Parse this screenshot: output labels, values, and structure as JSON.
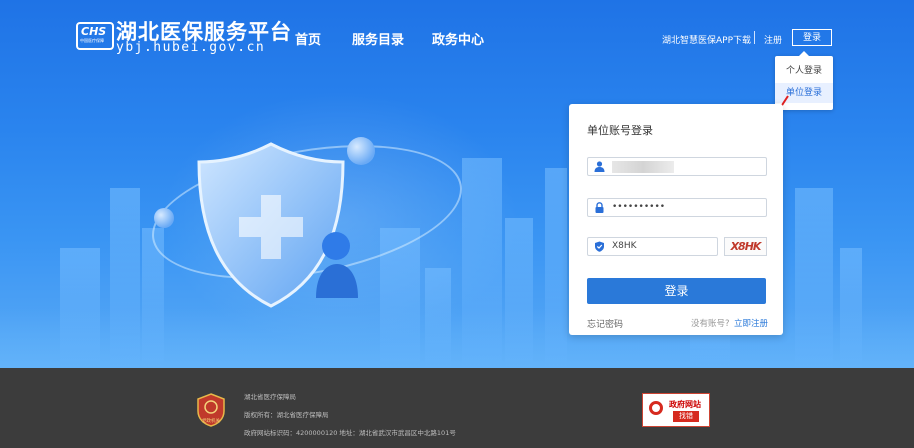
{
  "header": {
    "logo_text": "CHS",
    "logo_sub": "中国医疗保障",
    "site_title": "湖北医保服务平台",
    "site_url": "ybj.hubei.gov.cn",
    "nav": [
      "首页",
      "服务目录",
      "政务中心"
    ],
    "app_download": "湖北智慧医保APP下载",
    "register": "注册",
    "login": "登录"
  },
  "dropdown": {
    "items": [
      "个人登录",
      "单位登录"
    ],
    "active": "单位登录"
  },
  "login_card": {
    "title": "单位账号登录",
    "username_value": "",
    "password_value": "••••••••••",
    "captcha_value": "X8HK",
    "captcha_image_text": "X8HK",
    "submit": "登录",
    "forgot": "忘记密码",
    "no_account": "没有账号?",
    "register_now": "立即注册"
  },
  "footer": {
    "lines": [
      "湖北省医疗保障局",
      "版权所有：湖北省医疗保障局",
      "政府网站标识码：4200000120   地址：湖北省武汉市武昌区中北路101号"
    ],
    "emblem_label": "党政机关",
    "gov_badge_title": "政府网站",
    "gov_badge_sub": "找错"
  },
  "colors": {
    "hero_blue": "#1f73e6",
    "button_blue": "#2a79d9",
    "footer_bg": "#3c3c3c",
    "arrow_red": "#e02020"
  }
}
